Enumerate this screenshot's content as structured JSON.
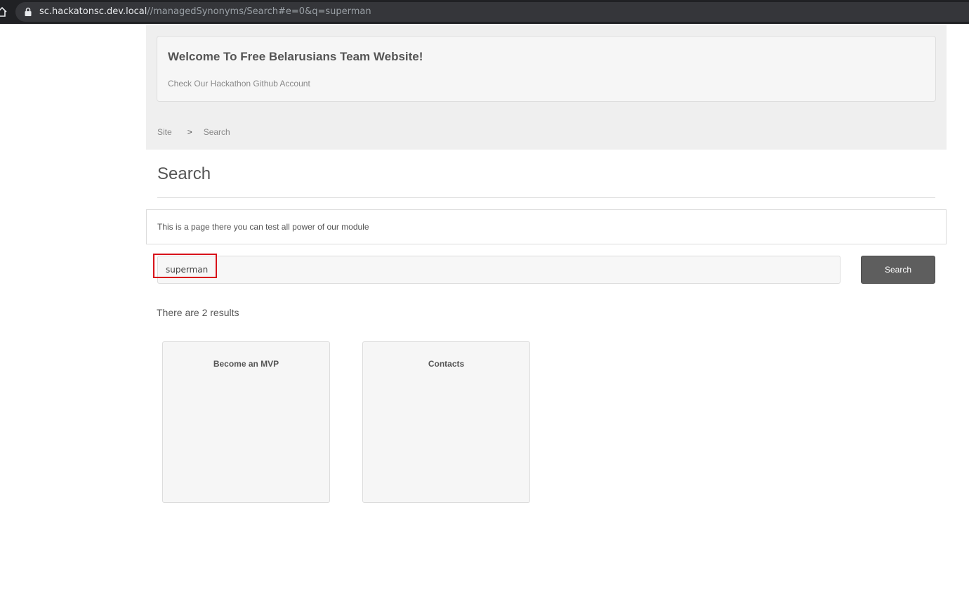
{
  "browser": {
    "url_host": "sc.hackatonsc.dev.local",
    "url_path": "//managedSynonyms/Search#e=0&q=superman"
  },
  "header": {
    "welcome_title": "Welcome To Free Belarusians Team Website!",
    "github_link": "Check Our Hackathon Github Account"
  },
  "breadcrumb": {
    "items": [
      "Site",
      "Search"
    ],
    "separator": ">"
  },
  "page": {
    "title": "Search",
    "intro": "This is a page there you can test all power of our module"
  },
  "search": {
    "query": "superman",
    "button_label": "Search"
  },
  "results": {
    "summary": "There are 2 results",
    "items": [
      {
        "title": "Become an MVP"
      },
      {
        "title": "Contacts"
      }
    ]
  },
  "colors": {
    "highlight": "#d8121a",
    "button": "#5e5e5e",
    "header_band": "#efefef"
  }
}
